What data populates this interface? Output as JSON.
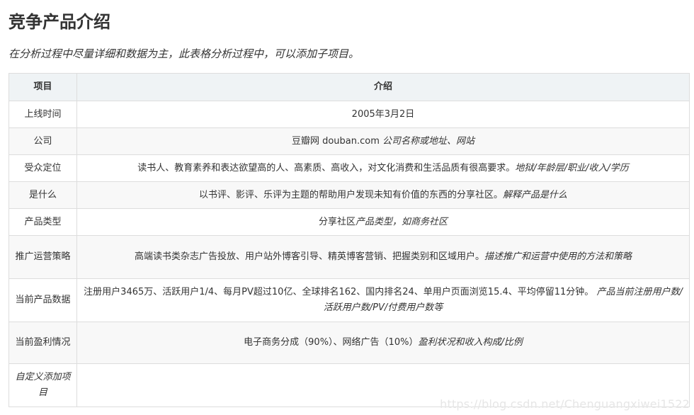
{
  "page": {
    "title": "竞争产品介绍",
    "intro": "在分析过程中尽量详细和数据为主，此表格分析过程中，可以添加子项目。"
  },
  "table": {
    "headers": [
      "项目",
      "介绍"
    ],
    "rows": [
      {
        "item": "上线时间",
        "value": "2005年3月2日",
        "note": ""
      },
      {
        "item": "公司",
        "value": "豆瓣网 douban.com ",
        "note": "公司名称或地址、网站"
      },
      {
        "item": "受众定位",
        "value": "读书人、教育素养和表达欲望高的人、高素质、高收入，对文化消费和生活品质有很高要求。",
        "note": "地狱/年龄层/职业/收入/学历"
      },
      {
        "item": "是什么",
        "value": "以书评、影评、乐评为主题的帮助用户发现未知有价值的东西的分享社区。",
        "note": "解释产品是什么"
      },
      {
        "item": "产品类型",
        "value": "分享社区",
        "note": "产品类型，如商务社区"
      },
      {
        "item": "推广运营策略",
        "value": "高端读书类杂志广告投放、用户站外博客引导、精英博客营销、把握类别和区域用户。",
        "note": "描述推广和运营中使用的方法和策略"
      },
      {
        "item": "当前产品数据",
        "value": "注册用户3465万、活跃用户1/4、每月PV超过10亿、全球排名162、国内排名24、单用户页面浏览15.4、平均停留11分钟。 ",
        "note": "产品当前注册用户数/活跃用户数/PV/付费用户数等"
      },
      {
        "item": "当前盈利情况",
        "value": "电子商务分成（90%）、网络广告（10%）",
        "note": "盈利状况和收入构成/比例"
      },
      {
        "item": "自定义添加项目",
        "value": "",
        "note": ""
      }
    ]
  },
  "watermark": "https://blog.csdn.net/Chenguangxiwei1522"
}
